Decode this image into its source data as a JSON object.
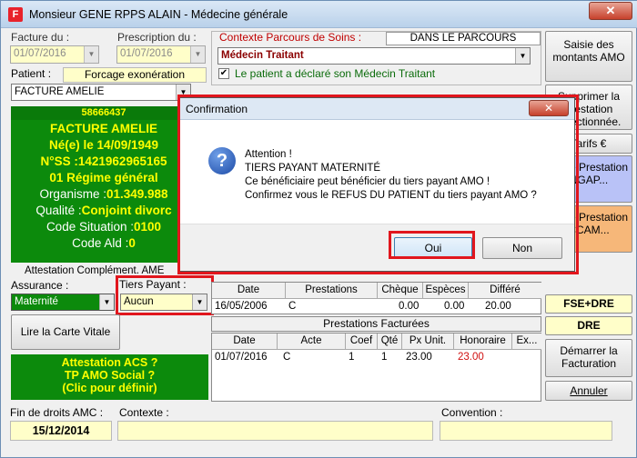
{
  "window": {
    "title": "Monsieur GENE RPPS ALAIN - Médecine générale",
    "app_icon": "F",
    "close": "✕"
  },
  "left": {
    "facture_du_label": "Facture du :",
    "facture_du_value": "01/07/2016",
    "prescription_du_label": "Prescription du :",
    "prescription_du_value": "01/07/2016",
    "patient_label": "Patient :",
    "forcage_label": "Forcage exonération",
    "patient_value": "FACTURE AMELIE",
    "patient_id": "58666437",
    "card": {
      "line1": "FACTURE AMELIE",
      "line2": "Né(e) le 14/09/1949",
      "line3": "N°SS :1421962965165",
      "line4": "01 Régime général",
      "organisme_label": "Organisme :",
      "organisme_value": "01.349.988",
      "qualite_label": "Qualité :",
      "qualite_value": "Conjoint divorc",
      "situation_label": "Code Situation :",
      "situation_value": "0100",
      "ald_label": "Code Ald :",
      "ald_value": "0"
    },
    "attestation_label": "Attestation Complément. AME",
    "assurance_label": "Assurance :",
    "assurance_value": "Maternité",
    "tiers_payant_label": "Tiers Payant :",
    "tiers_payant_value": "Aucun",
    "lire_carte_label": "Lire la Carte Vitale",
    "acs": {
      "line1": "Attestation ACS ?",
      "line2": "TP AMO Social ?",
      "line3": "(Clic pour définir)"
    }
  },
  "middle": {
    "contexte_label": "Contexte Parcours de Soins :",
    "parcours_value": "DANS LE PARCOURS",
    "medecin_value": "Médecin Traitant",
    "checkbox_label": "Le patient a déclaré son Médecin Traitant",
    "reglements": {
      "headers": [
        "Date",
        "Prestations",
        "Chèque",
        "Espèces",
        "Différé"
      ],
      "rows": [
        [
          "16/05/2006",
          "C",
          "0.00",
          "0.00",
          "20.00"
        ]
      ]
    },
    "prestations_title": "Prestations Facturées",
    "prestations": {
      "headers": [
        "Date",
        "Acte",
        "Coef",
        "Qté",
        "Px Unit.",
        "Honoraire",
        "Ex..."
      ],
      "rows": [
        [
          "01/07/2016",
          "C",
          "1",
          "1",
          "23.00",
          "23.00",
          ""
        ]
      ]
    }
  },
  "right": {
    "saisie_label": "Saisie des montants AMO",
    "supprimer_label": "Supprimer la prestation sélectionnée.",
    "tarifs_label": "Tarifs €",
    "autre_bas_label": "Autre Prestation NGAP...",
    "autre_ccam_label": "Autre Prestation CCAM...",
    "fse_dre_label": "FSE+DRE",
    "dre_label": "DRE",
    "demarrer_label": "Démarrer la Facturation",
    "annuler_label": "Annuler"
  },
  "bottom": {
    "fin_droits_label": "Fin de droits AMC :",
    "fin_droits_value": "15/12/2014",
    "contexte_label": "Contexte :",
    "convention_label": "Convention :"
  },
  "dialog": {
    "title": "Confirmation",
    "line1": "Attention !",
    "line2": "TIERS PAYANT MATERNITÉ",
    "line3": "Ce bénéficiaire peut bénéficier du tiers payant AMO !",
    "line4": "Confirmez vous le REFUS DU PATIENT du tiers payant AMO ?",
    "oui_label": "Oui",
    "non_label": "Non",
    "icon": "?",
    "close": "✕"
  },
  "colors": {
    "highlight": "#e1161d",
    "green": "#0c8a0c",
    "yellow_text": "#ffff00",
    "amount_red": "#d01010"
  }
}
